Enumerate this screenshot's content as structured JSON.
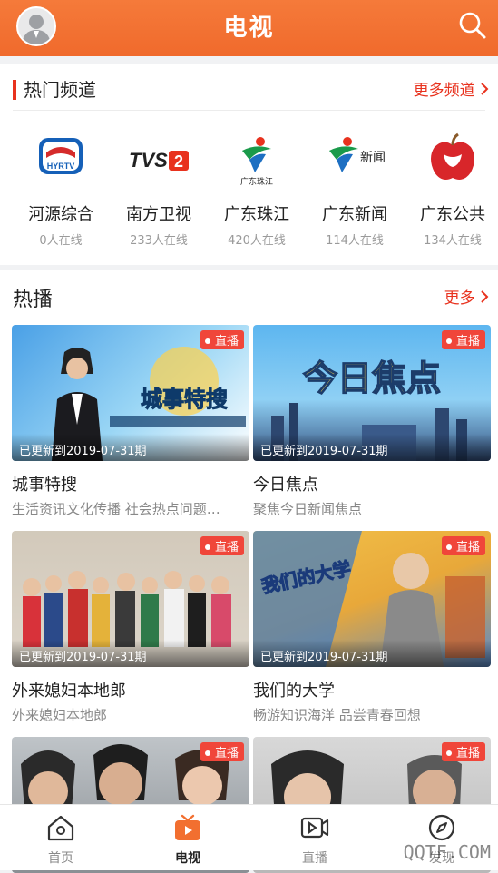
{
  "header": {
    "title": "电视"
  },
  "channels_section": {
    "title": "热门频道",
    "more_label": "更多频道",
    "channels": [
      {
        "name": "河源综合",
        "viewers": "0人在线",
        "logo_text": "HYRTV"
      },
      {
        "name": "南方卫视",
        "viewers": "233人在线",
        "logo_text": "TVS2"
      },
      {
        "name": "广东珠江",
        "viewers": "420人在线",
        "logo_text": "广东珠江"
      },
      {
        "name": "广东新闻",
        "viewers": "114人在线",
        "logo_text": "新闻"
      },
      {
        "name": "广东公共",
        "viewers": "134人在线",
        "logo_text": ""
      }
    ]
  },
  "hot_section": {
    "title": "热播",
    "more_label": "更多",
    "programs": [
      {
        "title": "城事特搜",
        "desc": "生活资讯文化传播 社会热点问题…",
        "update": "已更新到2019-07-31期",
        "badge": "直播",
        "thumb_text": "城事特搜"
      },
      {
        "title": "今日焦点",
        "desc": "聚焦今日新闻焦点",
        "update": "已更新到2019-07-31期",
        "badge": "直播",
        "thumb_text": "今日焦点"
      },
      {
        "title": "外来媳妇本地郎",
        "desc": "外来媳妇本地郎",
        "update": "已更新到2019-07-31期",
        "badge": "直播",
        "thumb_text": ""
      },
      {
        "title": "我们的大学",
        "desc": "畅游知识海洋 品尝青春回想",
        "update": "已更新到2019-07-31期",
        "badge": "直播",
        "thumb_text": "我们的大学"
      },
      {
        "title": "",
        "desc": "",
        "update": "",
        "badge": "直播",
        "thumb_text": ""
      },
      {
        "title": "",
        "desc": "",
        "update": "",
        "badge": "直播",
        "thumb_text": ""
      }
    ]
  },
  "tabbar": {
    "tabs": [
      {
        "label": "首页",
        "icon": "home-icon"
      },
      {
        "label": "电视",
        "icon": "tv-icon"
      },
      {
        "label": "直播",
        "icon": "video-icon"
      },
      {
        "label": "发现",
        "icon": "compass-icon"
      }
    ],
    "active": "电视"
  },
  "watermark": "QQTF.COM",
  "colors": {
    "brand": "#f26f30",
    "accent_red": "#e8321e",
    "badge": "#f0463a"
  }
}
